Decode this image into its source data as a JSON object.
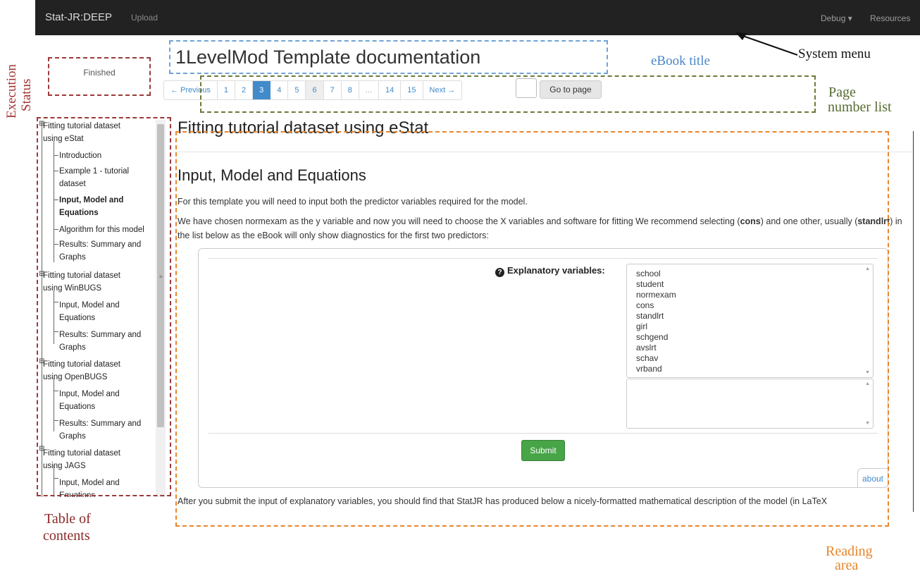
{
  "navbar": {
    "brand": "Stat-JR:DEEP",
    "upload": "Upload",
    "debug": "Debug ▾",
    "resources": "Resources"
  },
  "annotations": {
    "execution_status": [
      "Execution",
      "Status"
    ],
    "ebook_title": "eBook title",
    "system_menu": "System menu",
    "page_number_list": [
      "Page",
      "number list"
    ],
    "table_of_contents": [
      "Table of",
      "contents"
    ],
    "reading_area": [
      "Reading",
      "area"
    ]
  },
  "status": {
    "text": "Finished"
  },
  "ebook": {
    "title": "1LevelMod Template documentation"
  },
  "pagination": {
    "previous": "← Previous",
    "pages": [
      "1",
      "2",
      "3",
      "4",
      "5",
      "6",
      "7",
      "8",
      "...",
      "14",
      "15"
    ],
    "current_page": "3",
    "next": "Next →",
    "go_to_page": "Go to page"
  },
  "toc": {
    "items": [
      {
        "label1": "Fitting tutorial dataset",
        "label2": "using eStat"
      },
      {
        "label1": "Introduction"
      },
      {
        "label1": "Example 1 - tutorial",
        "label2": "dataset"
      },
      {
        "label1": "Input, Model and",
        "label2": "Equations"
      },
      {
        "label1": "Algorithm for this model"
      },
      {
        "label1": "Results: Summary and",
        "label2": "Graphs"
      },
      {
        "label1": "Fitting tutorial dataset",
        "label2": "using WinBUGS"
      },
      {
        "label1": "Input, Model and",
        "label2": "Equations"
      },
      {
        "label1": "Results: Summary and",
        "label2": "Graphs"
      },
      {
        "label1": "Fitting tutorial dataset",
        "label2": "using OpenBUGS"
      },
      {
        "label1": "Input, Model and",
        "label2": "Equations"
      },
      {
        "label1": "Results: Summary and",
        "label2": "Graphs"
      },
      {
        "label1": "Fitting tutorial dataset",
        "label2": "using JAGS"
      },
      {
        "label1": "Input, Model and",
        "label2": "Equations"
      }
    ]
  },
  "reading": {
    "heading": "Fitting tutorial dataset using eStat",
    "section": "Input, Model and Equations",
    "para1": "For this template you will need to input both the predictor variables required for the model.",
    "para2_a": "We have chosen normexam as the y variable and now you will need to choose the X variables and software for fitting We recommend selecting (",
    "para2_b": "cons",
    "para2_c": ") and one other, usually (",
    "para2_d": "standlrt",
    "para2_e": ") in the list below as the eBook will only show diagnostics for the first two predictors:",
    "para3": "After you submit the input of explanatory variables, you should find that StatJR has produced below a nicely-formatted mathematical description of the model (in LaTeX"
  },
  "form": {
    "label": "Explanatory variables:",
    "variables": [
      "school",
      "student",
      "normexam",
      "cons",
      "standlrt",
      "girl",
      "schgend",
      "avslrt",
      "schav",
      "vrband"
    ],
    "submit": "Submit",
    "about": "about"
  }
}
